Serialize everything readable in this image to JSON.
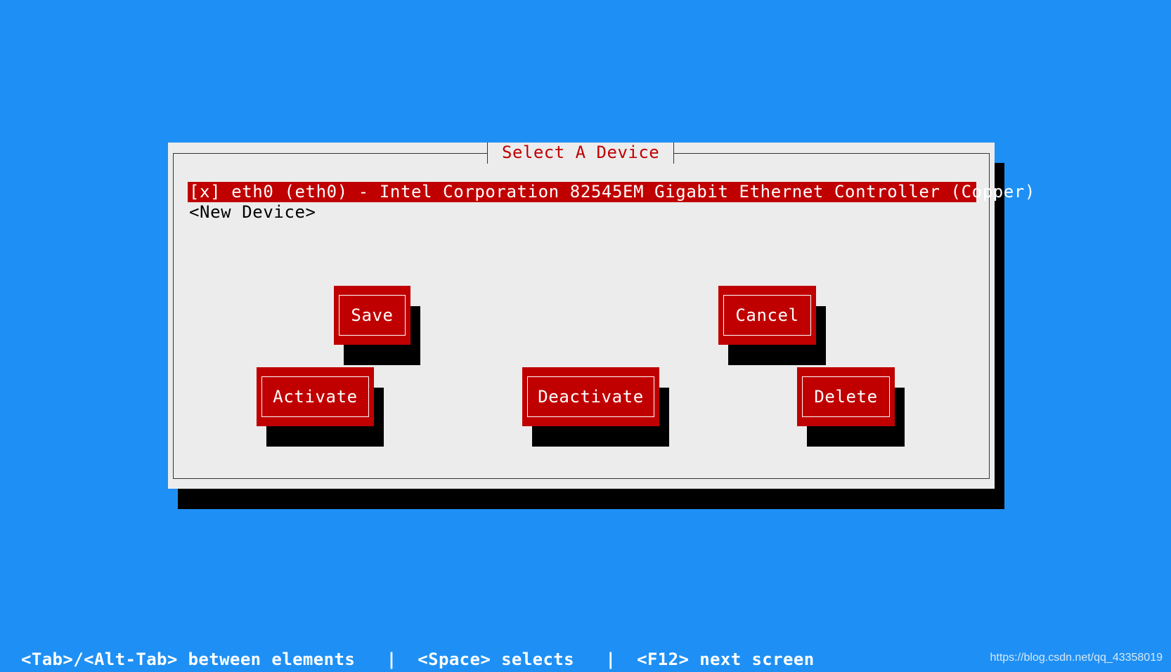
{
  "dialog": {
    "title": "Select A Device"
  },
  "devices": [
    {
      "label": "[x] eth0 (eth0) - Intel Corporation 82545EM Gigabit Ethernet Controller (Copper)",
      "selected": true
    },
    {
      "label": "<New Device>",
      "selected": false
    }
  ],
  "buttons": {
    "save": "Save",
    "cancel": "Cancel",
    "activate": "Activate",
    "deactivate": "Deactivate",
    "delete": "Delete"
  },
  "statusbar": {
    "text": "<Tab>/<Alt-Tab> between elements   |  <Space> selects   |  <F12> next screen"
  },
  "watermark": "https://blog.csdn.net/qq_43358019",
  "colors": {
    "background": "#1e90f5",
    "dialog": "#ececec",
    "accent": "#c00000",
    "shadow": "#000000"
  }
}
